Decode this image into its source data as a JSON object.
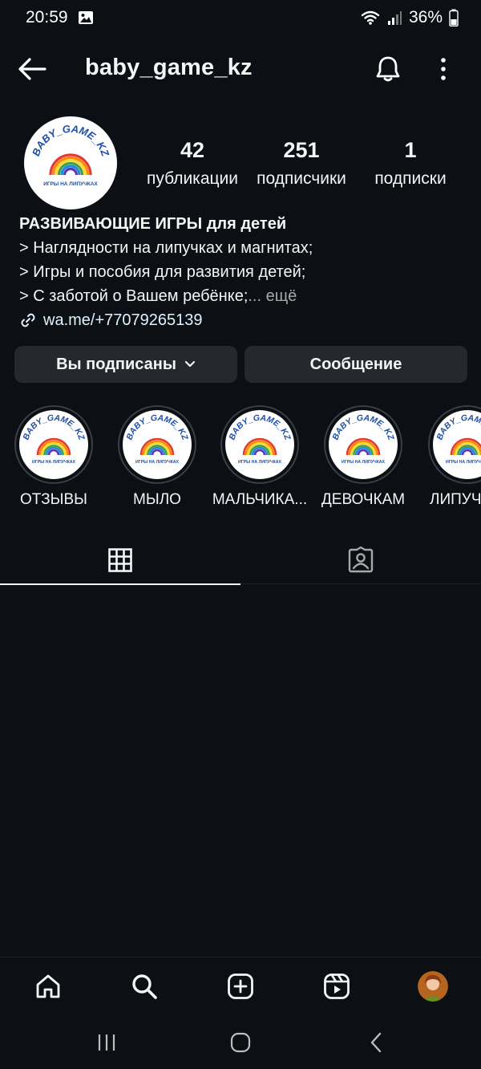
{
  "status": {
    "time": "20:59",
    "battery": "36%"
  },
  "header": {
    "username": "baby_game_kz"
  },
  "logo": {
    "brand_text": "BABY_GAME_KZ",
    "tagline": "ИГРЫ НА ЛИПУЧКАХ"
  },
  "stats": [
    {
      "value": "42",
      "label": "публикации"
    },
    {
      "value": "251",
      "label": "подписчики"
    },
    {
      "value": "1",
      "label": "подписки"
    }
  ],
  "bio": {
    "title": "РАЗВИВАЮЩИЕ ИГРЫ для детей",
    "lines": [
      "> Наглядности на липучках и магнитах;",
      "> Игры и пособия для развития детей;",
      "> С заботой о Вашем ребёнке;"
    ],
    "more": "... ещё",
    "link": "wa.me/+77079265139"
  },
  "actions": {
    "follow_label": "Вы подписаны",
    "message_label": "Сообщение"
  },
  "highlights": [
    {
      "label": "ОТЗЫВЫ"
    },
    {
      "label": "МЫЛО"
    },
    {
      "label": "МАЛЬЧИКА..."
    },
    {
      "label": "ДЕВОЧКАМ"
    },
    {
      "label": "ЛИПУЧ"
    }
  ],
  "colors": {
    "background": "#0c1014",
    "button_bg": "#25292e",
    "rainbow": [
      "#e53935",
      "#fb8c00",
      "#fdd835",
      "#43a047",
      "#1e88e5",
      "#5e35b1"
    ],
    "logo_text": "#1e4fa8"
  },
  "icons": {
    "back": "arrow-left-icon",
    "bell": "bell-icon",
    "more": "more-vertical-icon",
    "grid": "grid-icon",
    "tagged": "tagged-icon",
    "home": "home-icon",
    "search": "search-icon",
    "create": "plus-square-icon",
    "reels": "reels-icon"
  }
}
